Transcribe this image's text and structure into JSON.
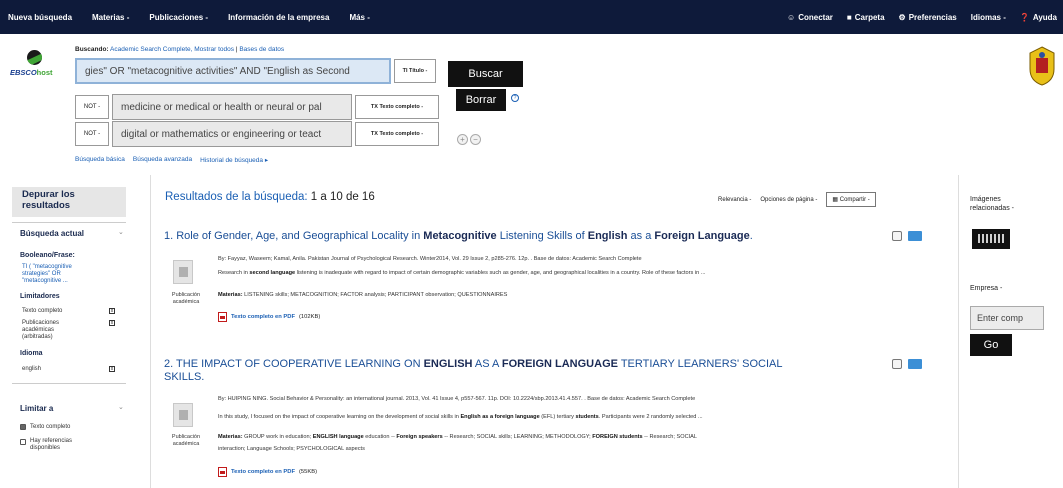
{
  "topnav": {
    "left": [
      "Nueva búsqueda",
      "Materias -",
      "Publicaciones -",
      "Información de la empresa",
      "Más -"
    ],
    "right": [
      "Conectar",
      "Carpeta",
      "Preferencias",
      "Idiomas -",
      "Ayuda"
    ]
  },
  "logo": {
    "brand": "EBSCO",
    "suffix": "host"
  },
  "searching": {
    "label": "Buscando:",
    "db": "Academic Search Complete,",
    "show_all": "Mostrar todos",
    "sep": "|",
    "choose": "Bases de datos"
  },
  "search_rows": [
    {
      "operator": "",
      "query": "gies\" OR \"metacognitive activities\" AND \"English as Second",
      "field": "TI Título -"
    },
    {
      "operator": "NOT -",
      "query": "medicine or medical or health or neural or pal",
      "field": "TX Texto completo -"
    },
    {
      "operator": "NOT -",
      "query": "digital or mathematics or engineering or teact",
      "field": "TX Texto completo -"
    }
  ],
  "buttons": {
    "search": "Buscar",
    "clear": "Borrar",
    "help": "?",
    "add": "+",
    "remove": "−"
  },
  "search_links": [
    "Búsqueda básica",
    "Búsqueda avanzada",
    "Historial de búsqueda ▸"
  ],
  "sidebar": {
    "refine": "Depurar los resultados",
    "current_search": "Búsqueda actual",
    "boolean_label": "Booleano/Frase:",
    "boolean_value": [
      "TI ( \"metacognitive",
      "strategies\" OR",
      "\"metacognitive ..."
    ],
    "limiters": "Limitadores",
    "limiter_items": [
      "Texto completo",
      "Publicaciones",
      "académicas",
      "(arbitradas)"
    ],
    "language_label": "Idioma",
    "language_value": "english",
    "limit_to": "Limitar a",
    "limit_items": [
      "Texto completo",
      "Hay referencias",
      "disponibles"
    ],
    "close": "x",
    "collapse": "⌄"
  },
  "results": {
    "label": "Resultados de la búsqueda:",
    "range": "1 a 10 de 16",
    "sort": "Relevancia -",
    "page_options": "Opciones de página -",
    "share": "Compartir -"
  },
  "result1": {
    "t1": "1. Role of Gender, Age, and Geographical Locality in ",
    "b1": "Metacognitive",
    "t2": " Listening Skills of ",
    "b2": "English",
    "t3": " as a ",
    "b3": "Foreign Language",
    "t4": ".",
    "meta": "By: Fayyaz, Waseem; Kamal, Anila. Pakistan Journal of Psychological Research. Winter2014, Vol. 29 Issue 2, p285-276. 12p. . Base de datos: Academic Search Complete",
    "abstract_a": "Research in ",
    "abstract_b": "second language",
    "abstract_c": " listening is inadequate with regard to impact of certain demographic variables such as gender, age, and geographical localities in a country. Role of these factors in ...",
    "subjects_label": "Materias:",
    "subjects": " LISTENING skills; METACOGNITION; FACTOR analysis; PARTICIPANT observation; QUESTIONNAIRES",
    "pdf": "Texto completo en PDF",
    "size": "(102KB)",
    "pubtype": "Publicación académica"
  },
  "result2": {
    "t1": "2. THE IMPACT OF COOPERATIVE LEARNING ON ",
    "b1": "ENGLISH",
    "t2": " AS A ",
    "b2": "FOREIGN LANGUAGE",
    "t3": " TERTIARY LEARNERS' SOCIAL",
    "t4": "SKILLS.",
    "meta": "By: HUIPING NING. Social Behavior & Personality: an international journal. 2013, Vol. 41 Issue 4, p557-567. 11p. DOI: 10.2224/sbp.2013.41.4.557. . Base de datos: Academic Search Complete",
    "abstract_a": "In this study, I focused on the impact of cooperative learning on the development of social skills in ",
    "abstract_b": "English as a foreign language",
    "abstract_c": " (EFL) tertiary ",
    "abstract_d": "students",
    "abstract_e": ". Participants were 2 randomly selected ...",
    "subjects_label": "Materias:",
    "subjects_a": " GROUP work in education; ",
    "subjects_b": "ENGLISH language",
    "subjects_c": " education -- ",
    "subjects_d": "Foreign speakers",
    "subjects_e": " -- Research; SOCIAL skills; LEARNING; METHODOLOGY; ",
    "subjects_f": "FOREIGN students",
    "subjects_g": " -- Research; SOCIAL",
    "subjects_line2": "interaction; Language Schools; PSYCHOLOGICAL aspects",
    "pdf": "Texto completo en PDF",
    "size": "(55KB)",
    "pubtype": "Publicación académica"
  },
  "rightcol": {
    "images_head": [
      "Imágenes",
      "relacionadas -"
    ],
    "company_head": "Empresa -",
    "company_input": "Enter comp",
    "go": "Go"
  },
  "colors": {
    "topnav": "#0e1a3a",
    "link": "#1a5fb4",
    "title": "#1a4e96",
    "dark_button": "#111111"
  }
}
